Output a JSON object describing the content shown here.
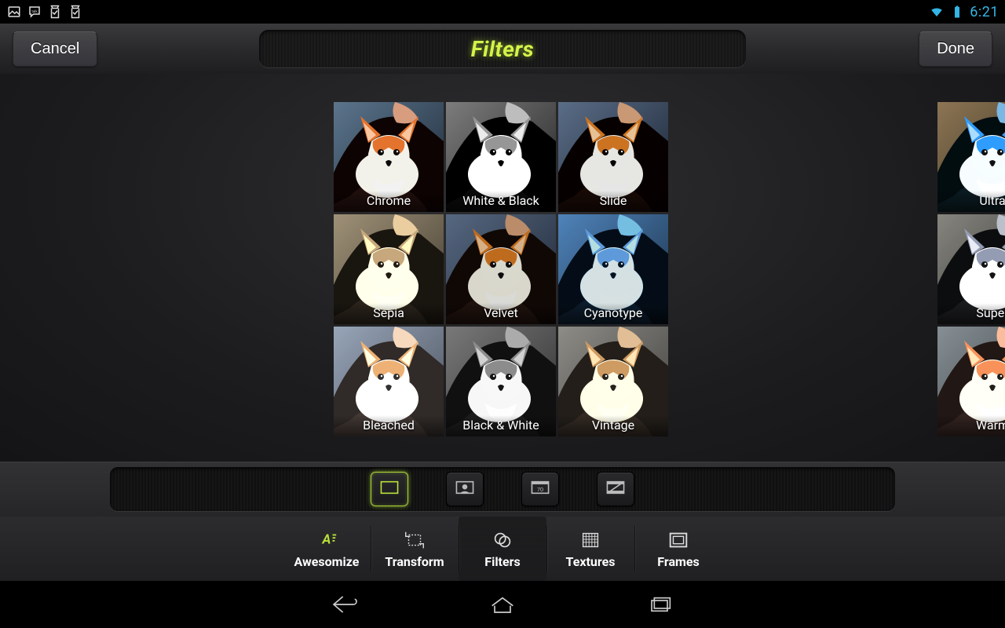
{
  "status": {
    "clock": "6:21"
  },
  "header": {
    "cancel": "Cancel",
    "title": "Filters",
    "done": "Done"
  },
  "filters_main": [
    {
      "name": "Chrome",
      "css_filter": "contrast(1.15) saturate(1.2) brightness(0.95) hue-rotate(-8deg)"
    },
    {
      "name": "White & Black",
      "css_filter": "grayscale(1) contrast(1.25) brightness(1.05)"
    },
    {
      "name": "Slide",
      "css_filter": "contrast(1.2) saturate(1.15) brightness(0.9)"
    },
    {
      "name": "Sepia",
      "css_filter": "sepia(0.85) contrast(1.05) brightness(1.02)"
    },
    {
      "name": "Velvet",
      "css_filter": "contrast(1.1) saturate(1.25) brightness(0.85)"
    },
    {
      "name": "Cyanotype",
      "css_filter": "grayscale(1) sepia(1) hue-rotate(170deg) saturate(2.2) brightness(0.85) contrast(1.1)"
    },
    {
      "name": "Bleached",
      "css_filter": "contrast(0.9) brightness(1.35) saturate(0.75)"
    },
    {
      "name": "Black & White",
      "css_filter": "grayscale(1) contrast(1.05)"
    },
    {
      "name": "Vintage",
      "css_filter": "sepia(0.5) contrast(0.95) brightness(1.05) saturate(1.1)"
    }
  ],
  "filters_side": [
    {
      "name": "Ultra",
      "css_filter": "hue-rotate(180deg) saturate(1.4) contrast(1.1)"
    },
    {
      "name": "Super",
      "css_filter": "grayscale(0.8) hue-rotate(200deg) brightness(1.1) contrast(1.1)"
    },
    {
      "name": "Warm",
      "css_filter": "sepia(0.3) saturate(1.25) brightness(1.1) hue-rotate(-12deg)"
    }
  ],
  "subcats": [
    {
      "id": "frame",
      "active": true
    },
    {
      "id": "portrait",
      "active": false
    },
    {
      "id": "seventy",
      "active": false,
      "badge": "70"
    },
    {
      "id": "film",
      "active": false
    }
  ],
  "tabs": [
    {
      "id": "awesomize",
      "label": "Awesomize",
      "active": false
    },
    {
      "id": "transform",
      "label": "Transform",
      "active": false
    },
    {
      "id": "filters",
      "label": "Filters",
      "active": true
    },
    {
      "id": "textures",
      "label": "Textures",
      "active": false
    },
    {
      "id": "frames",
      "label": "Frames",
      "active": false
    }
  ]
}
